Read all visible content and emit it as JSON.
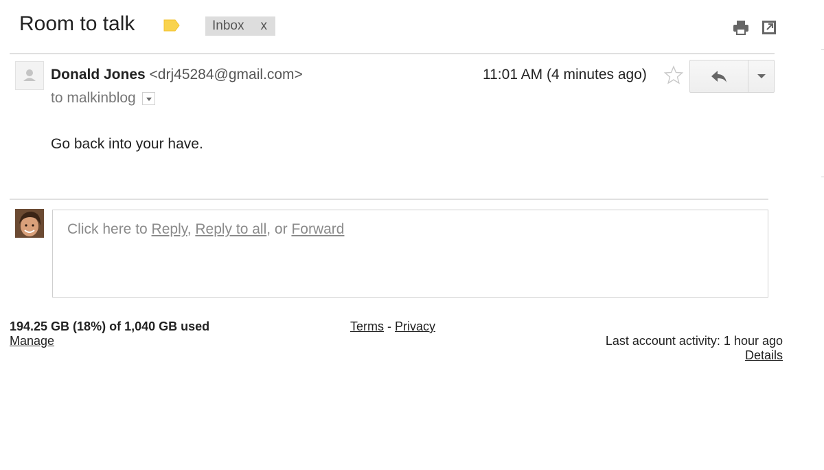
{
  "thread": {
    "subject": "Room to talk",
    "label_chip": {
      "label": "Inbox",
      "remove": "x"
    }
  },
  "message": {
    "sender_name": "Donald Jones",
    "sender_email": "<drj45284@gmail.com>",
    "recipient": "to malkinblog",
    "timestamp": "11:01 AM (4 minutes ago)",
    "body": "Go back into your have."
  },
  "reply_box": {
    "prefix": "Click here to ",
    "reply_label": "Reply",
    "sep1": ", ",
    "reply_all_label": "Reply to all",
    "sep2": ", or ",
    "forward_label": "Forward"
  },
  "footer": {
    "storage": "194.25 GB (18%) of 1,040 GB used",
    "manage": "Manage",
    "terms": "Terms",
    "separator": " - ",
    "privacy": "Privacy",
    "last_activity": "Last account activity: 1 hour ago",
    "details": "Details"
  },
  "icons": {
    "label_tag": "label-tag-icon",
    "print": "print-icon",
    "new_window": "new-window-icon",
    "star": "star-icon",
    "reply": "reply-arrow-icon",
    "more": "chevron-down-icon"
  },
  "colors": {
    "label_tag": "#f9d34e",
    "chip_bg": "#dddddd",
    "divider": "#e0e0e0"
  }
}
